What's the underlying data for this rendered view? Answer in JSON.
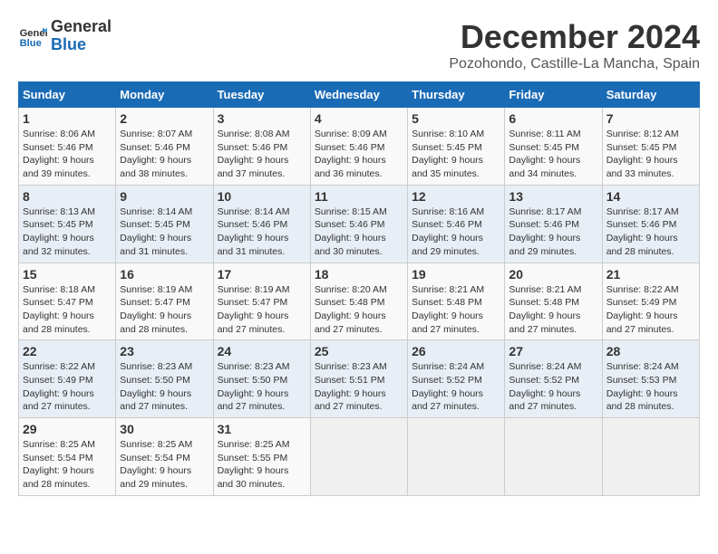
{
  "logo": {
    "text_general": "General",
    "text_blue": "Blue"
  },
  "header": {
    "title": "December 2024",
    "subtitle": "Pozohondo, Castille-La Mancha, Spain"
  },
  "weekdays": [
    "Sunday",
    "Monday",
    "Tuesday",
    "Wednesday",
    "Thursday",
    "Friday",
    "Saturday"
  ],
  "weeks": [
    [
      {
        "day": "1",
        "sunrise": "8:06 AM",
        "sunset": "5:46 PM",
        "daylight": "9 hours and 39 minutes."
      },
      {
        "day": "2",
        "sunrise": "8:07 AM",
        "sunset": "5:46 PM",
        "daylight": "9 hours and 38 minutes."
      },
      {
        "day": "3",
        "sunrise": "8:08 AM",
        "sunset": "5:46 PM",
        "daylight": "9 hours and 37 minutes."
      },
      {
        "day": "4",
        "sunrise": "8:09 AM",
        "sunset": "5:46 PM",
        "daylight": "9 hours and 36 minutes."
      },
      {
        "day": "5",
        "sunrise": "8:10 AM",
        "sunset": "5:45 PM",
        "daylight": "9 hours and 35 minutes."
      },
      {
        "day": "6",
        "sunrise": "8:11 AM",
        "sunset": "5:45 PM",
        "daylight": "9 hours and 34 minutes."
      },
      {
        "day": "7",
        "sunrise": "8:12 AM",
        "sunset": "5:45 PM",
        "daylight": "9 hours and 33 minutes."
      }
    ],
    [
      {
        "day": "8",
        "sunrise": "8:13 AM",
        "sunset": "5:45 PM",
        "daylight": "9 hours and 32 minutes."
      },
      {
        "day": "9",
        "sunrise": "8:14 AM",
        "sunset": "5:45 PM",
        "daylight": "9 hours and 31 minutes."
      },
      {
        "day": "10",
        "sunrise": "8:14 AM",
        "sunset": "5:46 PM",
        "daylight": "9 hours and 31 minutes."
      },
      {
        "day": "11",
        "sunrise": "8:15 AM",
        "sunset": "5:46 PM",
        "daylight": "9 hours and 30 minutes."
      },
      {
        "day": "12",
        "sunrise": "8:16 AM",
        "sunset": "5:46 PM",
        "daylight": "9 hours and 29 minutes."
      },
      {
        "day": "13",
        "sunrise": "8:17 AM",
        "sunset": "5:46 PM",
        "daylight": "9 hours and 29 minutes."
      },
      {
        "day": "14",
        "sunrise": "8:17 AM",
        "sunset": "5:46 PM",
        "daylight": "9 hours and 28 minutes."
      }
    ],
    [
      {
        "day": "15",
        "sunrise": "8:18 AM",
        "sunset": "5:47 PM",
        "daylight": "9 hours and 28 minutes."
      },
      {
        "day": "16",
        "sunrise": "8:19 AM",
        "sunset": "5:47 PM",
        "daylight": "9 hours and 28 minutes."
      },
      {
        "day": "17",
        "sunrise": "8:19 AM",
        "sunset": "5:47 PM",
        "daylight": "9 hours and 27 minutes."
      },
      {
        "day": "18",
        "sunrise": "8:20 AM",
        "sunset": "5:48 PM",
        "daylight": "9 hours and 27 minutes."
      },
      {
        "day": "19",
        "sunrise": "8:21 AM",
        "sunset": "5:48 PM",
        "daylight": "9 hours and 27 minutes."
      },
      {
        "day": "20",
        "sunrise": "8:21 AM",
        "sunset": "5:48 PM",
        "daylight": "9 hours and 27 minutes."
      },
      {
        "day": "21",
        "sunrise": "8:22 AM",
        "sunset": "5:49 PM",
        "daylight": "9 hours and 27 minutes."
      }
    ],
    [
      {
        "day": "22",
        "sunrise": "8:22 AM",
        "sunset": "5:49 PM",
        "daylight": "9 hours and 27 minutes."
      },
      {
        "day": "23",
        "sunrise": "8:23 AM",
        "sunset": "5:50 PM",
        "daylight": "9 hours and 27 minutes."
      },
      {
        "day": "24",
        "sunrise": "8:23 AM",
        "sunset": "5:50 PM",
        "daylight": "9 hours and 27 minutes."
      },
      {
        "day": "25",
        "sunrise": "8:23 AM",
        "sunset": "5:51 PM",
        "daylight": "9 hours and 27 minutes."
      },
      {
        "day": "26",
        "sunrise": "8:24 AM",
        "sunset": "5:52 PM",
        "daylight": "9 hours and 27 minutes."
      },
      {
        "day": "27",
        "sunrise": "8:24 AM",
        "sunset": "5:52 PM",
        "daylight": "9 hours and 27 minutes."
      },
      {
        "day": "28",
        "sunrise": "8:24 AM",
        "sunset": "5:53 PM",
        "daylight": "9 hours and 28 minutes."
      }
    ],
    [
      {
        "day": "29",
        "sunrise": "8:25 AM",
        "sunset": "5:54 PM",
        "daylight": "9 hours and 28 minutes."
      },
      {
        "day": "30",
        "sunrise": "8:25 AM",
        "sunset": "5:54 PM",
        "daylight": "9 hours and 29 minutes."
      },
      {
        "day": "31",
        "sunrise": "8:25 AM",
        "sunset": "5:55 PM",
        "daylight": "9 hours and 30 minutes."
      },
      null,
      null,
      null,
      null
    ]
  ]
}
